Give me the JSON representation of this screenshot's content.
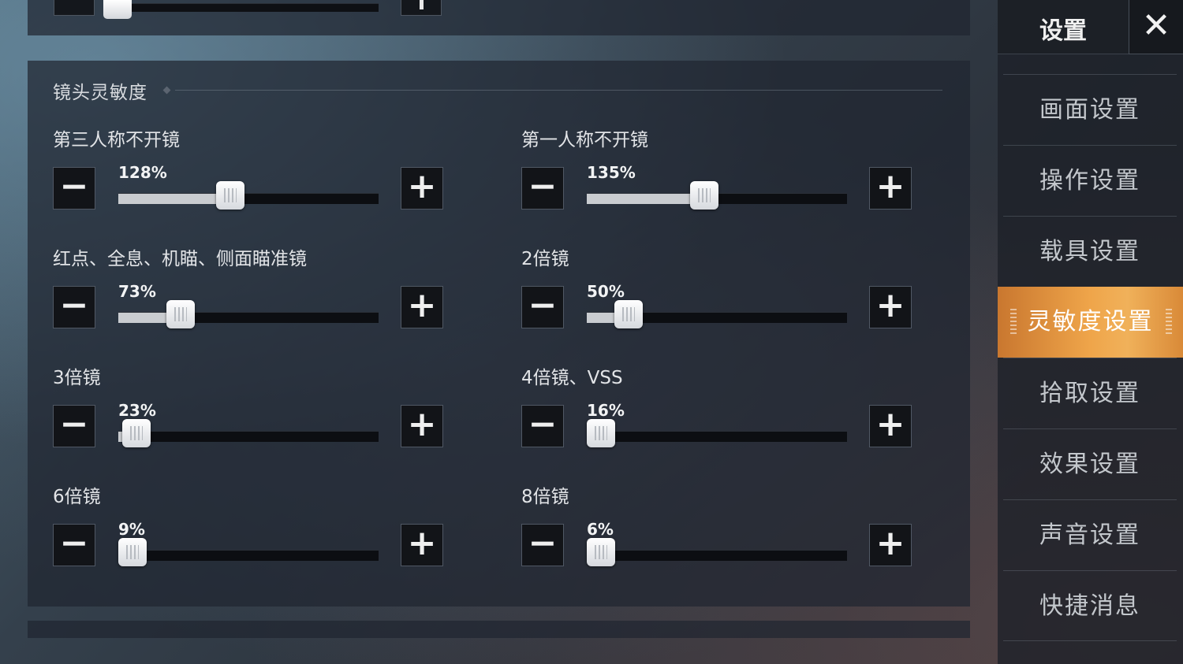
{
  "section": {
    "title": "镜头灵敏度"
  },
  "controls": {
    "minus_glyph": "−",
    "plus_glyph": "+"
  },
  "sliders": [
    {
      "label": "第三人称不开镜",
      "value_text": "128%",
      "level": 0.43
    },
    {
      "label": "第一人称不开镜",
      "value_text": "135%",
      "level": 0.45
    },
    {
      "label": "红点、全息、机瞄、侧面瞄准镜",
      "value_text": "73%",
      "level": 0.24
    },
    {
      "label": "2倍镜",
      "value_text": "50%",
      "level": 0.16
    },
    {
      "label": "3倍镜",
      "value_text": "23%",
      "level": 0.07
    },
    {
      "label": "4倍镜、VSS",
      "value_text": "16%",
      "level": 0.05
    },
    {
      "label": "6倍镜",
      "value_text": "9%",
      "level": 0.03
    },
    {
      "label": "8倍镜",
      "value_text": "6%",
      "level": 0.02
    }
  ],
  "sidebar": {
    "title": "设置",
    "close_glyph": "✕",
    "items": [
      {
        "label": "画面设置",
        "active": false
      },
      {
        "label": "操作设置",
        "active": false
      },
      {
        "label": "载具设置",
        "active": false
      },
      {
        "label": "灵敏度设置",
        "active": true
      },
      {
        "label": "拾取设置",
        "active": false
      },
      {
        "label": "效果设置",
        "active": false
      },
      {
        "label": "声音设置",
        "active": false
      },
      {
        "label": "快捷消息",
        "active": false
      }
    ]
  },
  "colors": {
    "accent": "#efa54a",
    "panel": "#202630",
    "track": "#0c0e12",
    "fill": "#c9ccd0"
  }
}
